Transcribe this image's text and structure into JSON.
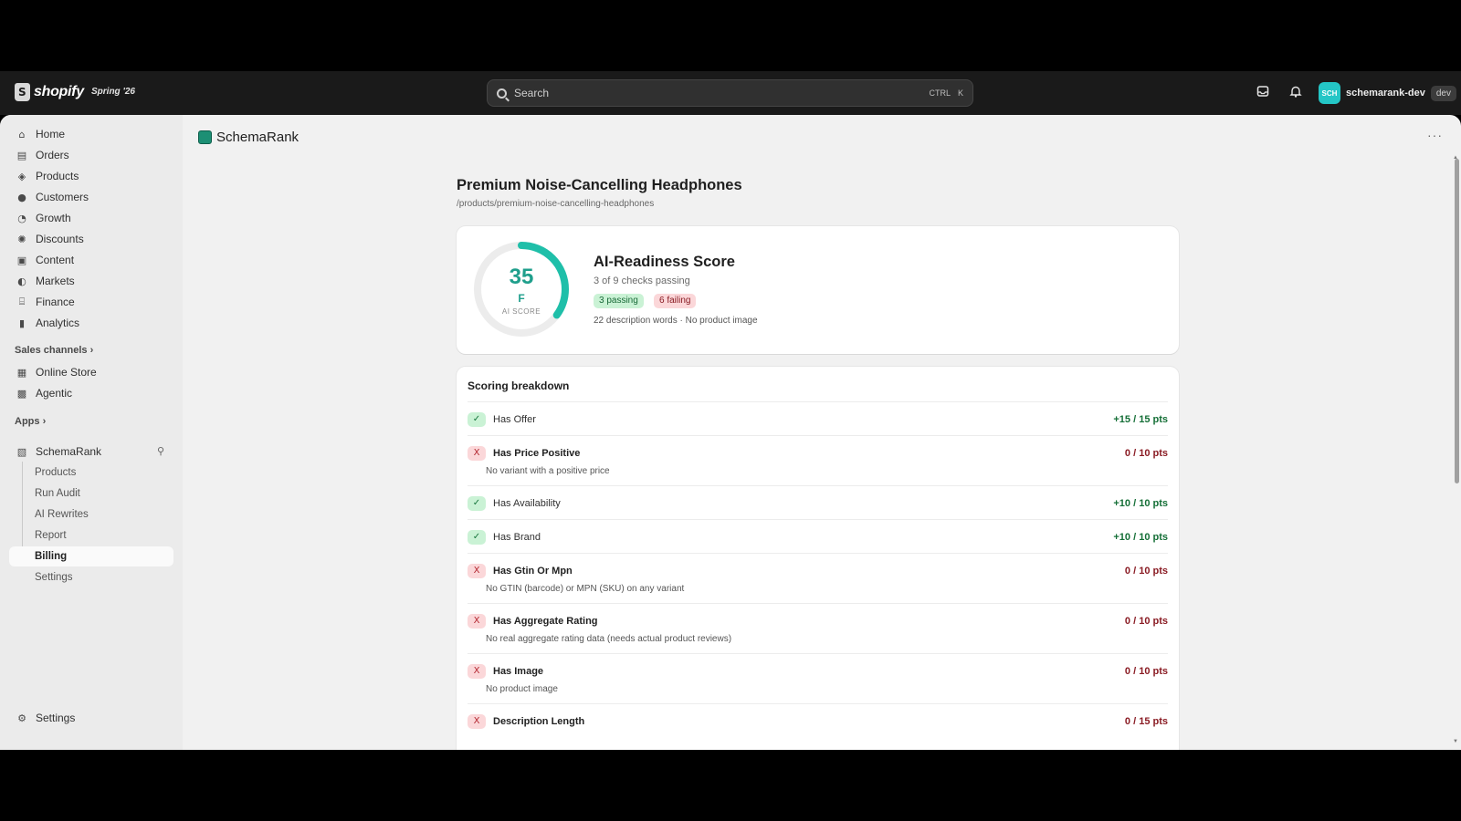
{
  "topbar": {
    "brand": "shopify",
    "edition": "Spring '26",
    "search_placeholder": "Search",
    "search_shortcut_1": "CTRL",
    "search_shortcut_2": "K",
    "store_avatar": "SCH",
    "store_name": "schemarank-dev",
    "store_badge": "dev"
  },
  "sidebar": {
    "items": [
      {
        "label": "Home",
        "icon": "home-icon"
      },
      {
        "label": "Orders",
        "icon": "orders-icon"
      },
      {
        "label": "Products",
        "icon": "tag-icon"
      },
      {
        "label": "Customers",
        "icon": "person-icon"
      },
      {
        "label": "Growth",
        "icon": "growth-icon"
      },
      {
        "label": "Discounts",
        "icon": "discount-icon"
      },
      {
        "label": "Content",
        "icon": "content-icon"
      },
      {
        "label": "Markets",
        "icon": "globe-icon"
      },
      {
        "label": "Finance",
        "icon": "bank-icon"
      },
      {
        "label": "Analytics",
        "icon": "bar-chart-icon"
      }
    ],
    "sales_channels_label": "Sales channels",
    "channels": [
      {
        "label": "Online Store",
        "icon": "store-icon"
      },
      {
        "label": "Agentic",
        "icon": "agentic-icon"
      }
    ],
    "apps_label": "Apps",
    "app": {
      "label": "SchemaRank",
      "icon": "app-icon"
    },
    "app_subitems": [
      "Products",
      "Run Audit",
      "AI Rewrites",
      "Report",
      "Billing",
      "Settings"
    ],
    "active_subitem": "Billing",
    "settings_label": "Settings"
  },
  "main": {
    "app_title": "SchemaRank",
    "product_title": "Premium Noise-Cancelling Headphones",
    "product_path": "/products/premium-noise-cancelling-headphones",
    "score": {
      "value": "35",
      "value_fraction": 0.35,
      "grade": "F",
      "gauge_label": "AI SCORE",
      "title": "AI-Readiness Score",
      "subtitle": "3 of 9 checks passing",
      "passing_badge": "3 passing",
      "failing_badge": "6 failing",
      "meta": "22 description words · No product image",
      "accent": "#1fbfa9"
    },
    "breakdown": {
      "title": "Scoring breakdown",
      "rows": [
        {
          "status": "pass",
          "mark": "✓",
          "name": "Has Offer",
          "note": "",
          "points": "+15 / 15 pts"
        },
        {
          "status": "fail",
          "mark": "X",
          "name": "Has Price Positive",
          "note": "No variant with a positive price",
          "points": "0 / 10 pts"
        },
        {
          "status": "pass",
          "mark": "✓",
          "name": "Has Availability",
          "note": "",
          "points": "+10 / 10 pts"
        },
        {
          "status": "pass",
          "mark": "✓",
          "name": "Has Brand",
          "note": "",
          "points": "+10 / 10 pts"
        },
        {
          "status": "fail",
          "mark": "X",
          "name": "Has Gtin Or Mpn",
          "note": "No GTIN (barcode) or MPN (SKU) on any variant",
          "points": "0 / 10 pts"
        },
        {
          "status": "fail",
          "mark": "X",
          "name": "Has Aggregate Rating",
          "note": "No real aggregate rating data (needs actual product reviews)",
          "points": "0 / 10 pts"
        },
        {
          "status": "fail",
          "mark": "X",
          "name": "Has Image",
          "note": "No product image",
          "points": "0 / 10 pts"
        },
        {
          "status": "fail",
          "mark": "X",
          "name": "Description Length",
          "note": "",
          "points": "0 / 15 pts"
        }
      ]
    }
  },
  "colors": {
    "pass_bg": "#caf2d5",
    "fail_bg": "#fbd7d9",
    "gauge": "#1fbfa9"
  }
}
